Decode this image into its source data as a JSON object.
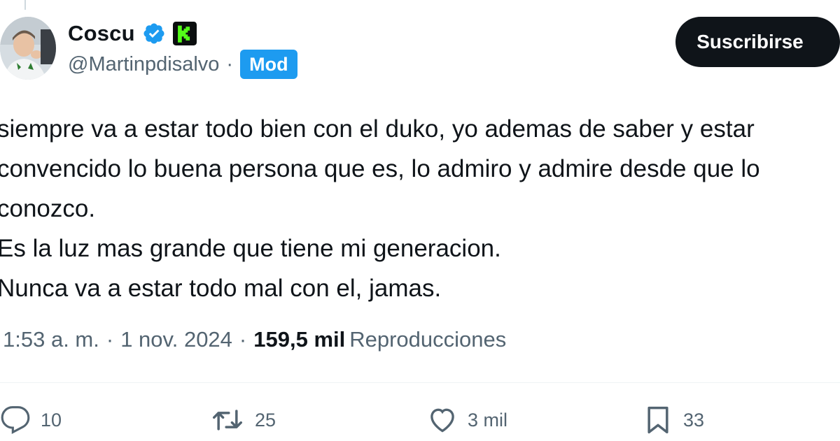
{
  "author": {
    "display_name": "Coscu",
    "handle": "@Martinpdisalvo",
    "separator": "·",
    "badge": "Mod",
    "verified_icon": "verified-badge-icon",
    "platform_icon": "kick-logo-icon"
  },
  "subscribe_label": "Suscribirse",
  "tweet": {
    "lines": [
      "siempre va a estar todo bien con el duko, yo ademas de saber y estar",
      "convencido lo buena persona que es, lo admiro y admire desde que lo",
      "conozco.",
      "Es la luz mas grande que tiene mi generacion.",
      "Nunca va a estar todo mal con el, jamas."
    ]
  },
  "meta": {
    "time": "1:53 a. m.",
    "sep1": "·",
    "date": "1 nov. 2024",
    "sep2": "·",
    "views_count": "159,5 mil",
    "views_label": "Reproducciones"
  },
  "actions": {
    "replies": "10",
    "reposts": "25",
    "likes": "3 mil",
    "bookmarks": "33"
  },
  "colors": {
    "text_primary": "#0f1419",
    "text_secondary": "#536471",
    "accent_blue": "#1d9bf0",
    "kick_green": "#53fc18",
    "button_bg": "#0f1419"
  }
}
